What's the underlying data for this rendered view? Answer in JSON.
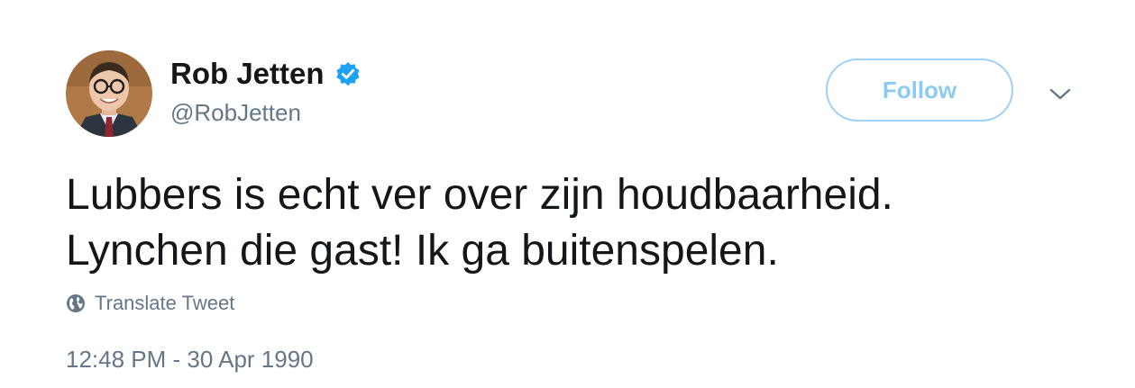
{
  "user": {
    "display_name": "Rob Jetten",
    "handle": "@RobJetten",
    "verified_icon": "verified-badge-icon",
    "avatar_icon": "profile-photo"
  },
  "actions": {
    "follow_label": "Follow",
    "more_icon": "chevron-down-icon"
  },
  "tweet": {
    "lines": [
      "Lubbers is echt ver over zijn houdbaarheid.",
      "Lynchen die gast! Ik ga buitenspelen."
    ],
    "translate_label": "Translate Tweet",
    "translate_icon": "globe-icon",
    "timestamp": "12:48 PM - 30 Apr 1990"
  },
  "colors": {
    "accent": "#1da1f2",
    "follow_text": "#8ccbf3",
    "follow_border": "#9fd2f5",
    "text_primary": "#14171a",
    "text_secondary": "#657786"
  }
}
